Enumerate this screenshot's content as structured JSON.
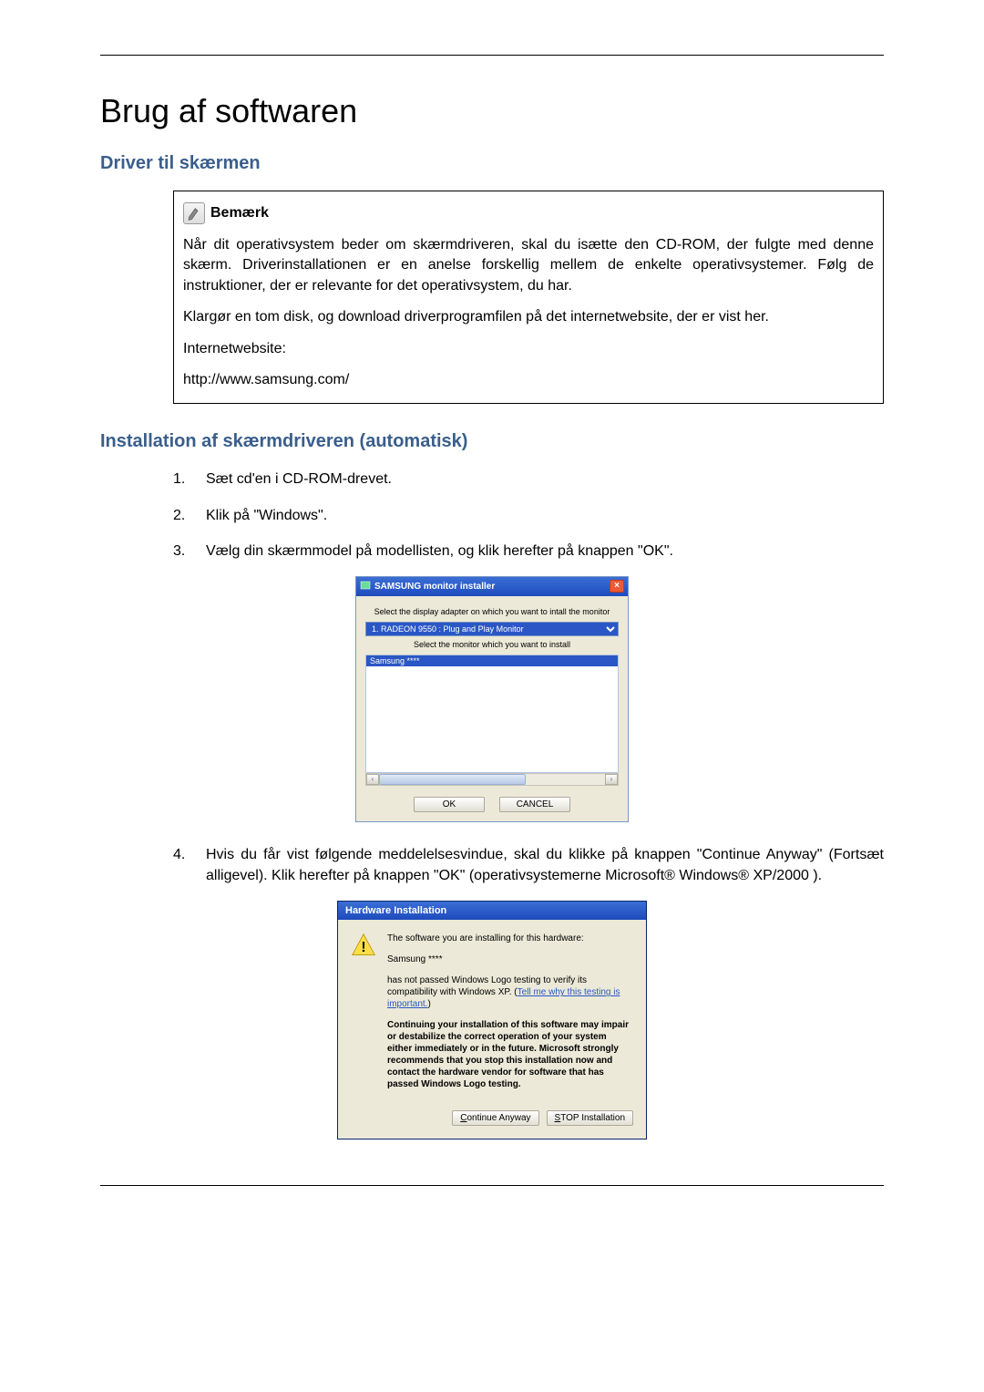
{
  "page": {
    "title": "Brug af softwaren",
    "section1_heading": "Driver til skærmen",
    "section2_heading": "Installation af skærmdriveren (automatisk)"
  },
  "note": {
    "label": "Bemærk",
    "para1": "Når dit operativsystem beder om skærmdriveren, skal du isætte den CD-ROM, der fulgte med denne skærm. Driverinstallationen er en anelse forskellig mellem de enkelte operativsystemer. Følg de instruktioner, der er relevante for det operativsystem, du har.",
    "para2": "Klargør en tom disk, og download driverprogramfilen på det internetwebsite, der er vist her.",
    "internet_label": "Internetwebsite:",
    "url": "http://www.samsung.com/"
  },
  "steps": {
    "s1_num": "1.",
    "s1_text": "Sæt cd'en i CD-ROM-drevet.",
    "s2_num": "2.",
    "s2_text": "Klik på \"Windows\".",
    "s3_num": "3.",
    "s3_text": "Vælg din skærmmodel på modellisten, og klik herefter på knappen \"OK\".",
    "s4_num": "4.",
    "s4_text": "Hvis du får vist følgende meddelelsesvindue, skal du klikke på knappen \"Continue Anyway\" (Fortsæt alligevel). Klik herefter på knappen \"OK\" (operativsystemerne Microsoft® Windows® XP/2000 )."
  },
  "installer": {
    "window_title": "SAMSUNG monitor installer",
    "prompt1": "Select the display adapter on which you want to intall the monitor",
    "adapter_option": "1. RADEON 9550 : Plug and Play Monitor",
    "prompt2": "Select the monitor which you want to install",
    "list_item": "Samsung ****",
    "ok_label": "OK",
    "cancel_label": "CANCEL"
  },
  "hw": {
    "window_title": "Hardware Installation",
    "line1": "The software you are installing for this hardware:",
    "line2": "Samsung ****",
    "line3a": "has not passed Windows Logo testing to verify its compatibility with Windows XP. (",
    "link": "Tell me why this testing is important.",
    "line3b": ")",
    "bold_para": "Continuing your installation of this software may impair or destabilize the correct operation of your system either immediately or in the future. Microsoft strongly recommends that you stop this installation now and contact the hardware vendor for software that has passed Windows Logo testing.",
    "continue_label": "Continue Anyway",
    "stop_label": "STOP Installation"
  }
}
